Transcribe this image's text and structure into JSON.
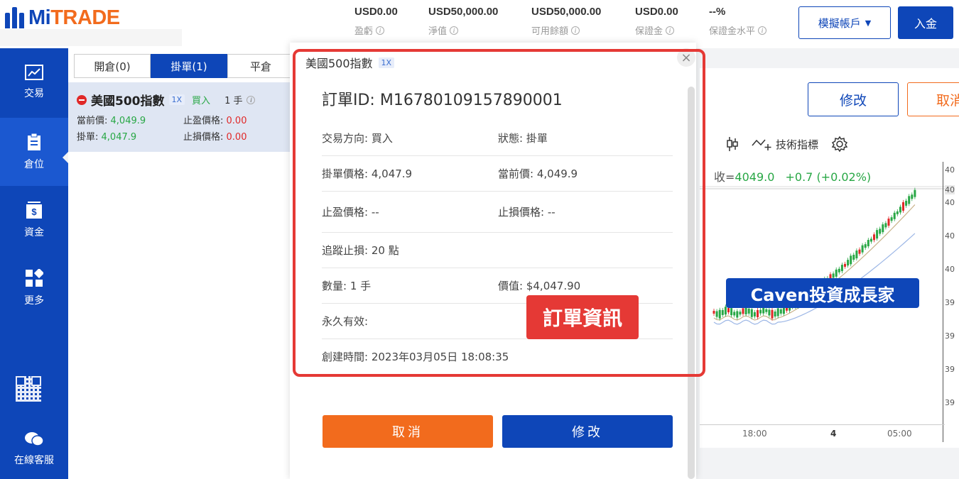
{
  "brand": {
    "logo_mi": "Mi",
    "logo_trade": "TRADE"
  },
  "account": {
    "stats": [
      {
        "value": "USD0.00",
        "label": "盈虧"
      },
      {
        "value": "USD50,000.00",
        "label": "淨值"
      },
      {
        "value": "USD50,000.00",
        "label": "可用餘額"
      },
      {
        "value": "USD0.00",
        "label": "保證金"
      },
      {
        "value": "--%",
        "label": "保證金水平"
      }
    ],
    "demo_button": "模擬帳戶",
    "deposit_button": "入金"
  },
  "sidebar": {
    "items": [
      {
        "label": "交易",
        "icon": "chart-line-icon"
      },
      {
        "label": "倉位",
        "icon": "clipboard-icon"
      },
      {
        "label": "資金",
        "icon": "wallet-icon"
      },
      {
        "label": "更多",
        "icon": "grid-icon"
      }
    ],
    "support": "在線客服"
  },
  "positions": {
    "tabs": [
      {
        "label": "開倉(0)",
        "active": false
      },
      {
        "label": "掛單(1)",
        "active": true
      },
      {
        "label": "平倉",
        "active": false
      }
    ],
    "order": {
      "name": "美國500指數",
      "leverage": "1X",
      "direction": "買入",
      "lots": "1 手",
      "current_label": "當前價:",
      "current_value": "4,049.9",
      "pending_label": "掛單:",
      "pending_value": "4,047.9",
      "tp_label": "止盈價格:",
      "tp_value": "0.00",
      "sl_label": "止損價格:",
      "sl_value": "0.00"
    }
  },
  "modal": {
    "title": "美國500指數",
    "leverage": "1X",
    "order_id": "訂單ID: M16780109157890001",
    "rows": [
      {
        "l1": "交易方向:",
        "v1": "買入",
        "l2": "狀態:",
        "v2": "掛單"
      },
      {
        "l1": "掛單價格:",
        "v1": "4,047.9",
        "l2": "當前價:",
        "v2": "4,049.9"
      },
      {
        "l1": "止盈價格:",
        "v1": "--",
        "l2": "止損價格:",
        "v2": "--"
      },
      {
        "l1": "追蹤止損:",
        "v1": "20 點",
        "l2": "",
        "v2": ""
      },
      {
        "l1": "數量:",
        "v1": "1 手",
        "l2": "價值:",
        "v2": "$4,047.90"
      },
      {
        "l1": "永久有效:",
        "v1": "",
        "l2": "",
        "v2": ""
      },
      {
        "l1": "創建時間:",
        "v1": "2023年03月05日 18:08:35",
        "l2": "",
        "v2": ""
      }
    ],
    "cancel_button": "取消",
    "modify_button": "修改",
    "annotation": "訂單資訊"
  },
  "chart": {
    "modify_button": "修改",
    "cancel_button": "取消",
    "indicators_label": "技術指標",
    "close_prefix": "收=",
    "close_value": "4049.0",
    "change": "+0.7 (+0.02%)",
    "time_ticks": [
      "18:00",
      "4",
      "05:00"
    ],
    "price_ticks": [
      "40",
      "40",
      "40",
      "40",
      "39",
      "39",
      "39",
      "39"
    ],
    "watermark": "Caven投資成長家",
    "colors": {
      "up": "#28a745",
      "down": "#e02828",
      "ma1": "#c9b38a",
      "ma2": "#9db7e6"
    }
  }
}
